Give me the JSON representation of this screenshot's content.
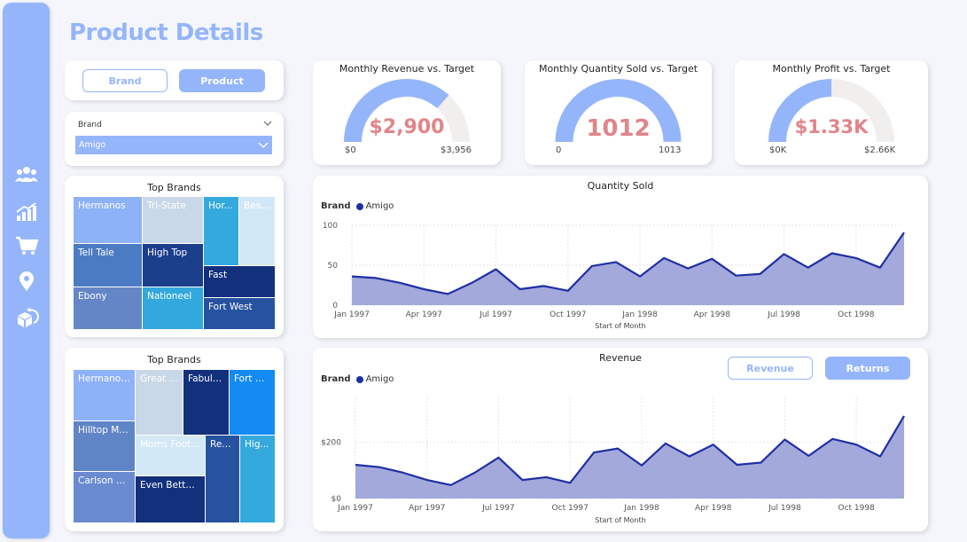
{
  "page": {
    "title": "Product Details"
  },
  "sidebar": {
    "icons": [
      "users-icon",
      "growth-chart-icon",
      "shopping-cart-icon",
      "location-pin-icon",
      "returns-box-icon"
    ]
  },
  "toggle": {
    "brand_label": "Brand",
    "product_label": "Product",
    "active": "Product"
  },
  "slicer": {
    "label": "Brand",
    "selected": "Amigo"
  },
  "treemap1": {
    "title": "Top Brands",
    "tiles": [
      "Hermanos",
      "Tri-State",
      "Hor...",
      "Best...",
      "Tell Tale",
      "High Top",
      "Fast",
      "Ebony",
      "Nationeel",
      "Fort West"
    ]
  },
  "treemap2": {
    "title": "Top Brands",
    "tiles": [
      "Hermanos...",
      "Great ...",
      "Fabulo...",
      "Fort W...",
      "Hilltop Mi...",
      "Moms Foot...",
      "Red...",
      "Hig...",
      "Carlson H...",
      "Even Better ..."
    ]
  },
  "gauges": [
    {
      "title": "Monthly Revenue vs. Target",
      "value_label": "$2,900",
      "min_label": "$0",
      "max_label": "$3,956",
      "fraction": 0.733
    },
    {
      "title": "Monthly Quantity Sold vs. Target",
      "value_label": "1012",
      "min_label": "0",
      "max_label": "1013",
      "fraction": 0.999
    },
    {
      "title": "Monthly Profit vs. Target",
      "value_label": "$1.33K",
      "min_label": "$0K",
      "max_label": "$2.66K",
      "fraction": 0.5
    }
  ],
  "qty_chart": {
    "title": "Quantity Sold",
    "legend_title": "Brand",
    "legend_item": "Amigo",
    "x_title": "Start of Month"
  },
  "rev_chart": {
    "title": "Revenue",
    "legend_title": "Brand",
    "legend_item": "Amigo",
    "x_title": "Start of Month",
    "btn_revenue": "Revenue",
    "btn_returns": "Returns"
  },
  "colors": {
    "accent": "#95b5fb",
    "line": "#1f2fa3",
    "area": "#9ea4d9",
    "gauge_value": "#e0858a"
  },
  "chart_data": [
    {
      "type": "area",
      "title": "Quantity Sold",
      "xlabel": "Start of Month",
      "ylabel": "",
      "x_tick_labels": [
        "Jan 1997",
        "Apr 1997",
        "Jul 1997",
        "Oct 1997",
        "Jan 1998",
        "Apr 1998",
        "Jul 1998",
        "Oct 1998"
      ],
      "y_tick_labels": [
        "0",
        "50",
        "100"
      ],
      "ylim": [
        0,
        100
      ],
      "legend": "top-left",
      "series": [
        {
          "name": "Amigo",
          "values": [
            36,
            34,
            28,
            20,
            14,
            28,
            45,
            20,
            24,
            18,
            49,
            54,
            36,
            59,
            46,
            58,
            37,
            39,
            64,
            47,
            65,
            59,
            47,
            91
          ]
        }
      ]
    },
    {
      "type": "area",
      "title": "Revenue",
      "xlabel": "Start of Month",
      "ylabel": "",
      "x_tick_labels": [
        "Jan 1997",
        "Apr 1997",
        "Jul 1997",
        "Oct 1997",
        "Jan 1998",
        "Apr 1998",
        "Jul 1998",
        "Oct 1998"
      ],
      "y_tick_labels": [
        "$0",
        "$200"
      ],
      "ylim": [
        0,
        360
      ],
      "legend": "top-left",
      "series": [
        {
          "name": "Amigo",
          "values": [
            120,
            112,
            92,
            66,
            48,
            92,
            146,
            66,
            76,
            56,
            164,
            178,
            118,
            196,
            150,
            192,
            120,
            128,
            210,
            152,
            212,
            192,
            150,
            294
          ]
        }
      ]
    }
  ]
}
